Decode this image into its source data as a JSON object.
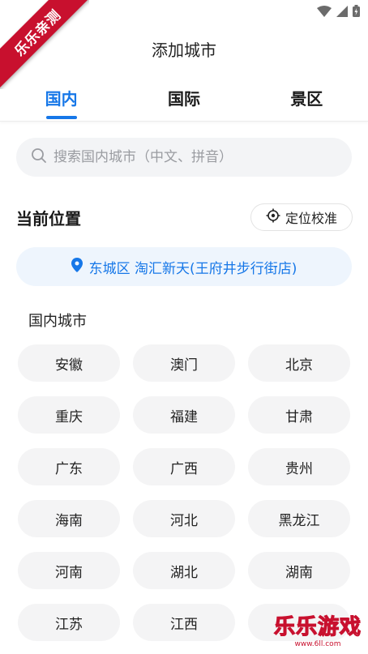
{
  "ribbon": {
    "text": "乐乐亲测"
  },
  "header": {
    "title": "添加城市"
  },
  "tabs": [
    {
      "label": "国内",
      "active": true
    },
    {
      "label": "国际",
      "active": false
    },
    {
      "label": "景区",
      "active": false
    }
  ],
  "search": {
    "placeholder": "搜索国内城市（中文、拼音）"
  },
  "current_location": {
    "title": "当前位置",
    "locate_label": "定位校准",
    "address": "东城区 淘汇新天(王府井步行街店)"
  },
  "cities": {
    "title": "国内城市",
    "items": [
      "安徽",
      "澳门",
      "北京",
      "重庆",
      "福建",
      "甘肃",
      "广东",
      "广西",
      "贵州",
      "海南",
      "河北",
      "黑龙江",
      "河南",
      "湖北",
      "湖南",
      "江苏",
      "江西",
      ""
    ]
  },
  "watermark": {
    "main": "乐乐游戏",
    "sub": "www.6ll.com"
  },
  "colors": {
    "accent": "#1677e8",
    "chip_bg": "#f4f4f5",
    "location_bg": "#eef5fd",
    "ribbon": "#c8102e"
  },
  "icons": {
    "back": "chevron-left-icon",
    "search": "search-icon",
    "locate": "crosshair-icon",
    "pin": "location-pin-icon",
    "wifi": "wifi-icon",
    "signal": "signal-icon",
    "battery": "battery-icon"
  }
}
